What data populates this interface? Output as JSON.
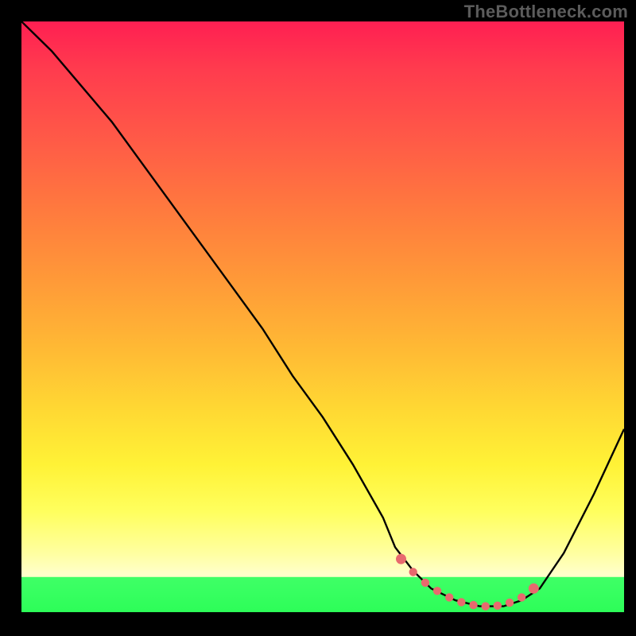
{
  "watermark": "TheBottleneck.com",
  "chart_data": {
    "type": "line",
    "title": "",
    "xlabel": "",
    "ylabel": "",
    "xlim": [
      0,
      100
    ],
    "ylim": [
      0,
      100
    ],
    "series": [
      {
        "name": "bottleneck-curve",
        "x": [
          0,
          5,
          10,
          15,
          20,
          25,
          30,
          35,
          40,
          45,
          50,
          55,
          60,
          62,
          65,
          68,
          72,
          76,
          80,
          83,
          86,
          90,
          95,
          100
        ],
        "y": [
          100,
          95,
          89,
          83,
          76,
          69,
          62,
          55,
          48,
          40,
          33,
          25,
          16,
          11,
          7,
          4,
          2,
          1,
          1,
          2,
          4,
          10,
          20,
          31
        ]
      }
    ],
    "highlight_dots": {
      "name": "optimal-range",
      "x": [
        63,
        65,
        67,
        69,
        71,
        73,
        75,
        77,
        79,
        81,
        83,
        85
      ],
      "y": [
        9,
        6.8,
        5,
        3.6,
        2.5,
        1.7,
        1.2,
        1,
        1.1,
        1.6,
        2.5,
        4
      ]
    },
    "band_threshold_y": 5.9
  }
}
